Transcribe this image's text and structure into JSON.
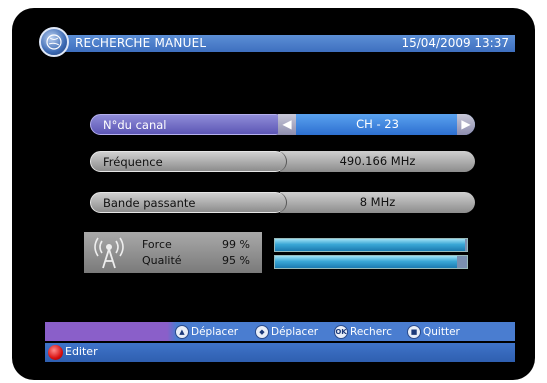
{
  "header": {
    "title": "RECHERCHE MANUEL",
    "datetime": "15/04/2009 13:37"
  },
  "fields": [
    {
      "label": "N°du canal",
      "value": "CH - 23",
      "selected": true
    },
    {
      "label": "Fréquence",
      "value": "490.166 MHz",
      "selected": false
    },
    {
      "label": "Bande passante",
      "value": "8 MHz",
      "selected": false
    }
  ],
  "signal": {
    "strength_label": "Force",
    "strength_value": "99 %",
    "strength_level": 0.99,
    "quality_label": "Qualité",
    "quality_value": "95 %",
    "quality_level": 0.95
  },
  "navbar": {
    "items": [
      {
        "icon": "up-down-arrows-icon",
        "label": "Déplacer"
      },
      {
        "icon": "left-right-arrows-icon",
        "label": "Déplacer"
      },
      {
        "icon": "ok-button-icon",
        "glyph": "OK",
        "label": "Recherc"
      },
      {
        "icon": "exit-button-icon",
        "label": "Quitter"
      }
    ]
  },
  "editbar": {
    "label": "Editer"
  },
  "colors": {
    "accent_blue": "#3e6fbf",
    "selected_purple": "#5c56b5",
    "signal_cyan": "#3aa7d6",
    "red_button": "#d81010"
  }
}
